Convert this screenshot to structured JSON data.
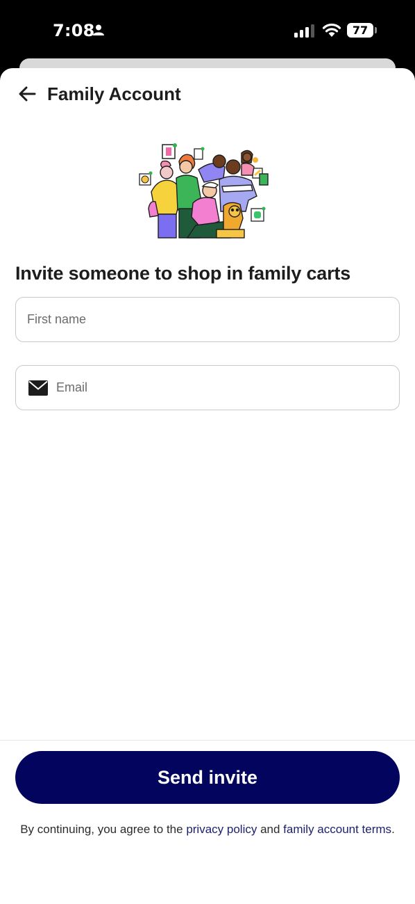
{
  "status_bar": {
    "time": "7:08",
    "battery": "77"
  },
  "header": {
    "title": "Family Account",
    "back_icon": "arrow-left-icon"
  },
  "illustration": {
    "icon": "family-group-illustration"
  },
  "form": {
    "heading": "Invite someone to shop in family carts",
    "first_name_placeholder": "First name",
    "first_name_value": "",
    "email_placeholder": "Email",
    "email_value": "",
    "email_icon": "envelope-icon"
  },
  "footer": {
    "send_label": "Send invite",
    "legal_prefix": "By continuing, you agree to the ",
    "privacy_link": "privacy policy",
    "legal_and": " and ",
    "terms_link": "family account terms",
    "legal_suffix": "."
  },
  "colors": {
    "primary_button": "#03045e",
    "link": "#1b1f6e"
  }
}
